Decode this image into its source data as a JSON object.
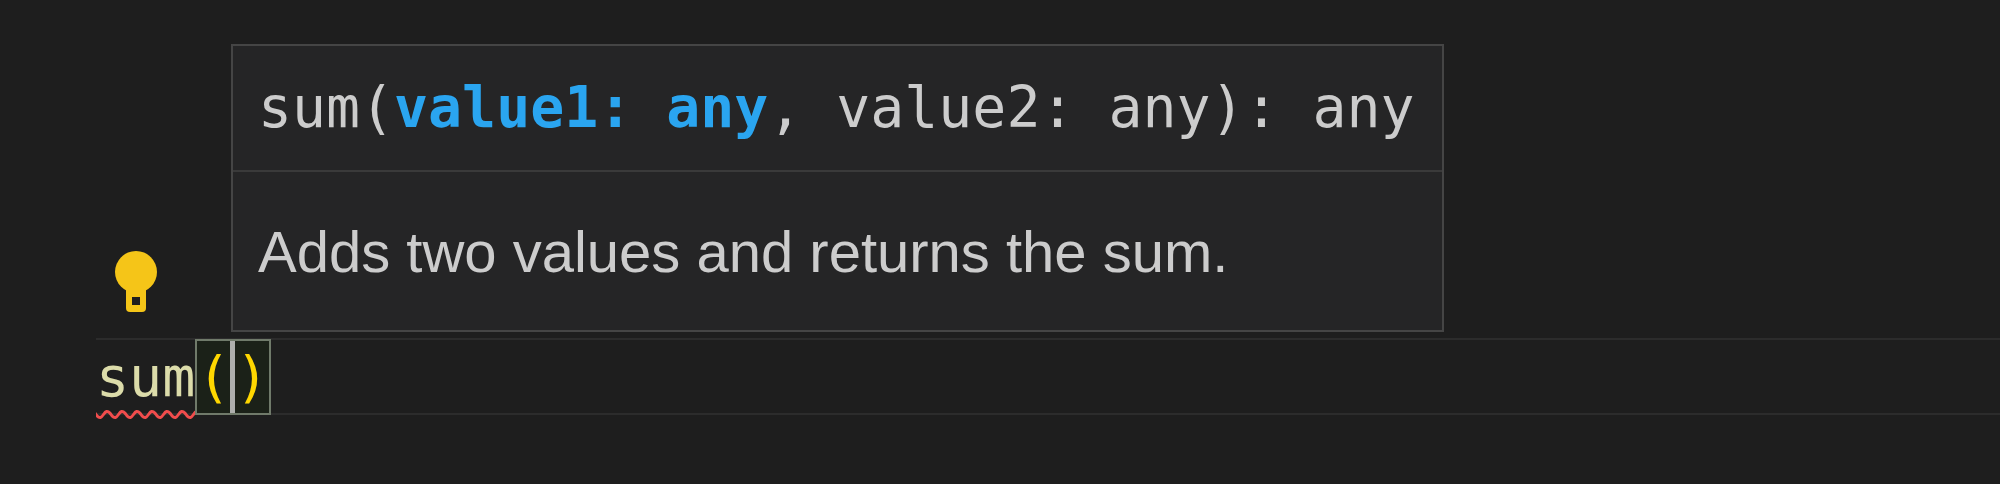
{
  "hover": {
    "signature": {
      "before": "sum(",
      "active_parameter": "value1: any",
      "after": ", value2: any): any"
    },
    "description": "Adds two values and returns the sum."
  },
  "code_line": {
    "function_name": "sum",
    "open_bracket": "(",
    "close_bracket": ")",
    "error": true,
    "brackets_matched": true
  }
}
